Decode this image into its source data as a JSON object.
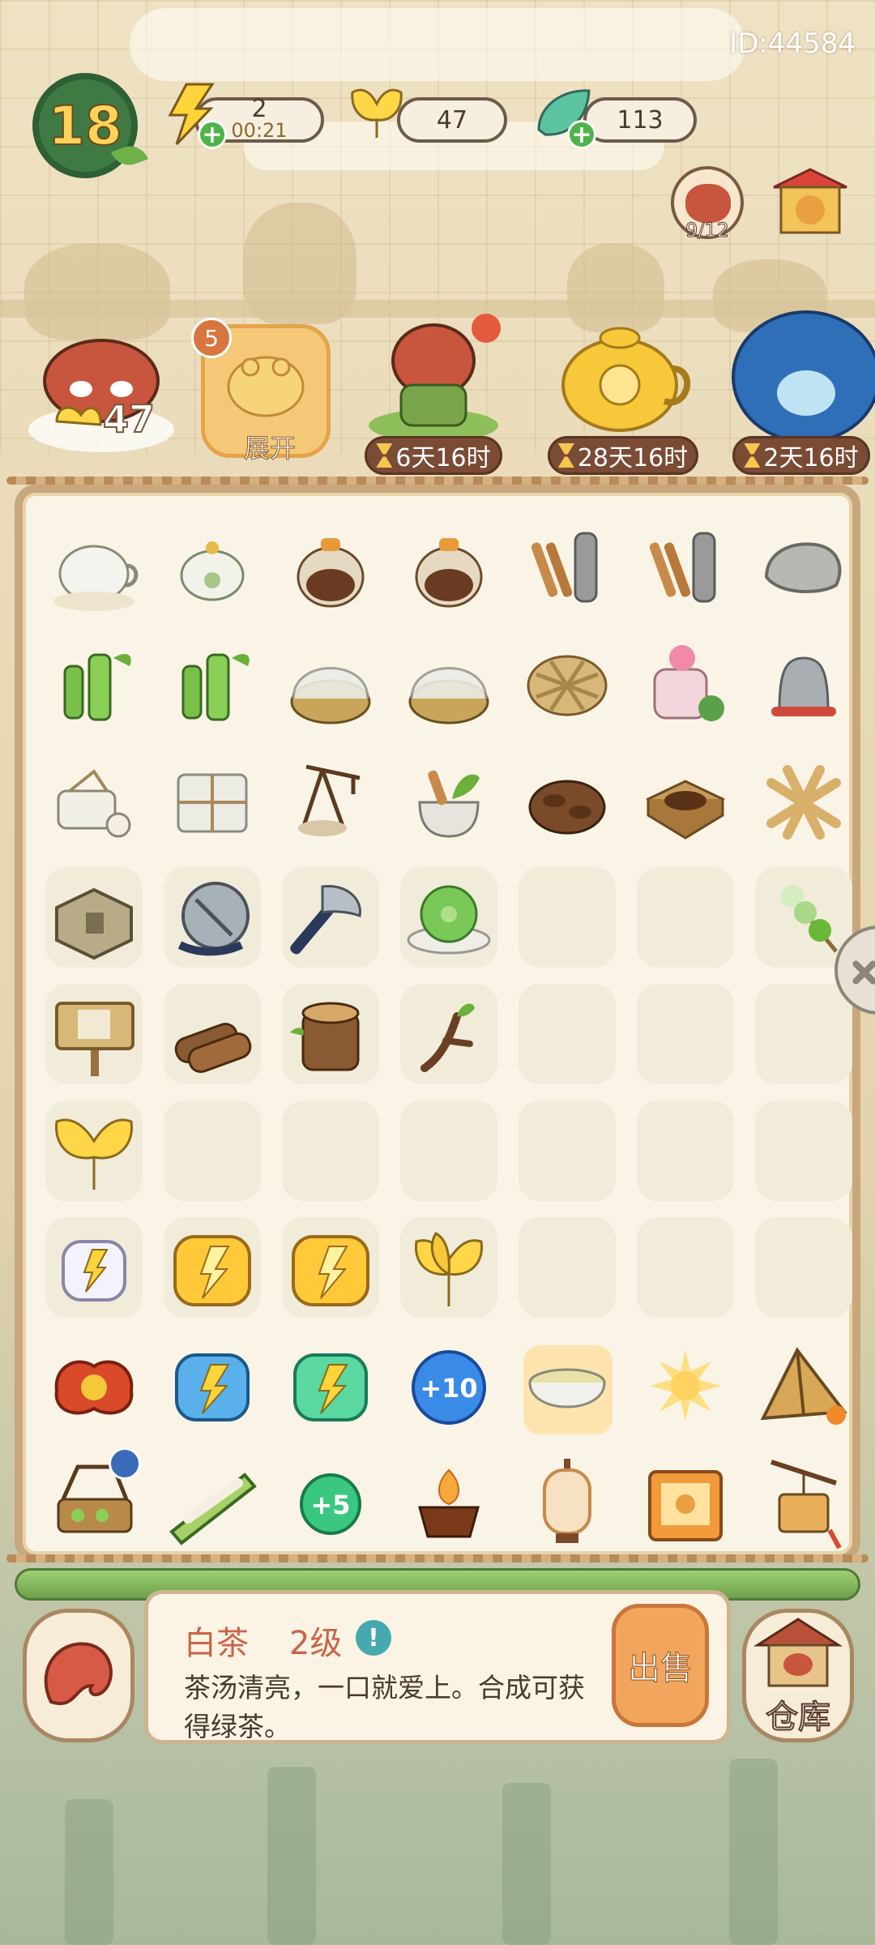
{
  "header": {
    "player_id": "ID:44584",
    "level": "18",
    "energy": {
      "value": "2",
      "timer": "00:21",
      "icon": "lightning-icon"
    },
    "gold_leaf": {
      "value": "47",
      "icon": "ginkgo-leaf-icon"
    },
    "green_leaf": {
      "value": "113",
      "icon": "green-leaf-icon"
    },
    "avatar_count": "9/12"
  },
  "events": {
    "coin_count": "47",
    "expand_badge": "5",
    "expand_label": "展开",
    "timers": [
      "6天16时",
      "28天16时",
      "2天16时"
    ]
  },
  "board": {
    "rows": [
      [
        "teapot-cloud",
        "teapot-small",
        "fire-jar",
        "fire-jar",
        "cinnamon-scroll",
        "cinnamon-scroll",
        "stone"
      ],
      [
        "bamboo",
        "bamboo",
        "covered-basket",
        "covered-basket",
        "woven-mat",
        "lotus-jar",
        "bell"
      ],
      [
        "white-bundle",
        "paper-package",
        "tea-scale",
        "mortar-herbs",
        "dark-leaves",
        "tea-box",
        "woven-knot"
      ],
      [
        "stone-block",
        "grinder",
        "axe",
        "green-pastry",
        "empty",
        "empty",
        "dango"
      ],
      [
        "wooden-sign",
        "logs",
        "tree-stump",
        "branch",
        "empty",
        "empty",
        "empty"
      ],
      [
        "ginkgo-leaf",
        "empty",
        "empty",
        "empty",
        "empty",
        "empty",
        "empty"
      ],
      [
        "energy-card-small",
        "energy-card-gold",
        "energy-card-gold",
        "ginkgo-bundle",
        "empty",
        "empty",
        "empty"
      ],
      [
        "red-lucky-cloud",
        "energy-card-blue",
        "energy-card-green",
        "bonus-10",
        "tea-bowl",
        "gold-splash",
        "tent"
      ],
      [
        "tea-stand",
        "bamboo-noodles",
        "bonus-5",
        "brazier",
        "lantern",
        "paw-lantern",
        "hanging-basket"
      ]
    ],
    "bonus_10": "+10",
    "bonus_5": "+5"
  },
  "info": {
    "item_name": "白茶",
    "item_level": "2级",
    "info_icon": "!",
    "description": "茶汤清亮，一口就爱上。合成可获得绿茶。",
    "sell_label": "出售",
    "storage_label": "仓库"
  },
  "colors": {
    "board_bg": "#f9f4e6",
    "board_border": "#c9a77c",
    "accent_orange": "#f2a55c",
    "title_red": "#c9644a"
  }
}
